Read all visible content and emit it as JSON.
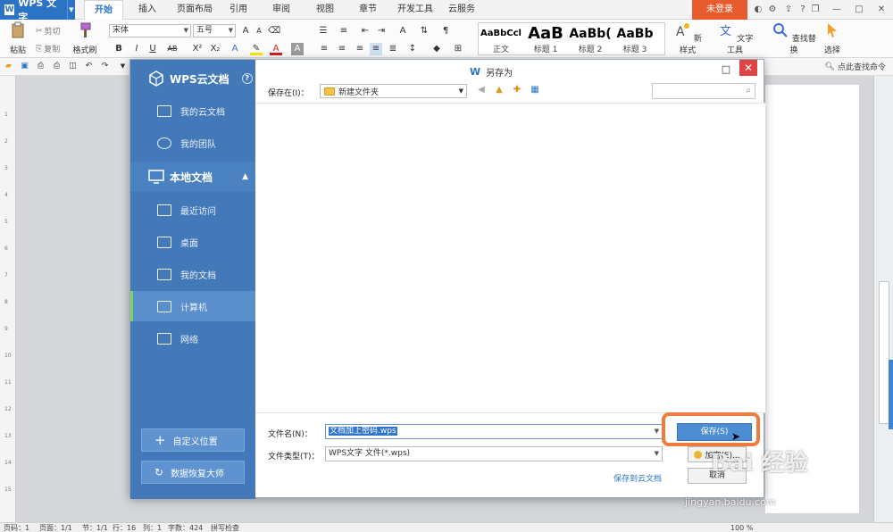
{
  "app": {
    "name": "WPS 文字",
    "logo_letter": "W"
  },
  "tabs": [
    "开始",
    "插入",
    "页面布局",
    "引用",
    "审阅",
    "视图",
    "章节",
    "开发工具",
    "云服务"
  ],
  "active_tab": "开始",
  "login_label": "未登录",
  "ribbon": {
    "paste": "粘贴",
    "cut": "剪切",
    "copy": "复制",
    "format_painter": "格式刷",
    "font_name": "宋体",
    "font_size": "五号",
    "styles": [
      {
        "sample": "AaBbCcl",
        "name": "正文"
      },
      {
        "sample": "AaB",
        "name": "标题 1"
      },
      {
        "sample": "AaBb(",
        "name": "标题 2"
      },
      {
        "sample": "AaBb",
        "name": "标题 3"
      }
    ],
    "new_style": "新样式",
    "text_tools": "文字工具",
    "find_replace": "查找替换",
    "select": "选择"
  },
  "quick_bar": {
    "find_command": "点此查找命令"
  },
  "dialog": {
    "title": "另存为",
    "side": {
      "cloud_header": "WPS云文档",
      "cloud_items": [
        "我的云文档",
        "我的团队"
      ],
      "local_header": "本地文档",
      "local_items": [
        "最近访问",
        "桌面",
        "我的文档",
        "计算机",
        "网络"
      ],
      "selected_item": "计算机",
      "custom_location": "自定义位置",
      "data_recovery": "数据恢复大师"
    },
    "save_in_label": "保存在(I)：",
    "save_in_value": "新建文件夹",
    "file_name_label": "文件名(N)：",
    "file_name_value": "文档加上密码.wps",
    "file_type_label": "文件类型(T)：",
    "file_type_value": "WPS文字 文件(*.wps)",
    "save_to_cloud": "保存到云文档",
    "save_button": "保存(S)",
    "encrypt_button": "加密(E)...",
    "cancel_button": "取消"
  },
  "status": {
    "page_num": "页码：1",
    "pages": "页面：1/1",
    "section": "节：1/1",
    "row": "行：16",
    "col": "列：1",
    "word_count": "字数：424",
    "spell": "拼写检查",
    "zoom": "100 %"
  },
  "watermark": {
    "text": "Bai 经验",
    "url": "jingyan.baidu.com"
  },
  "colors": {
    "accent": "#2b73c4",
    "login": "#e85b2c",
    "sidebar": "#4379b8",
    "highlight": "#ef7b3c",
    "close": "#e04343"
  }
}
